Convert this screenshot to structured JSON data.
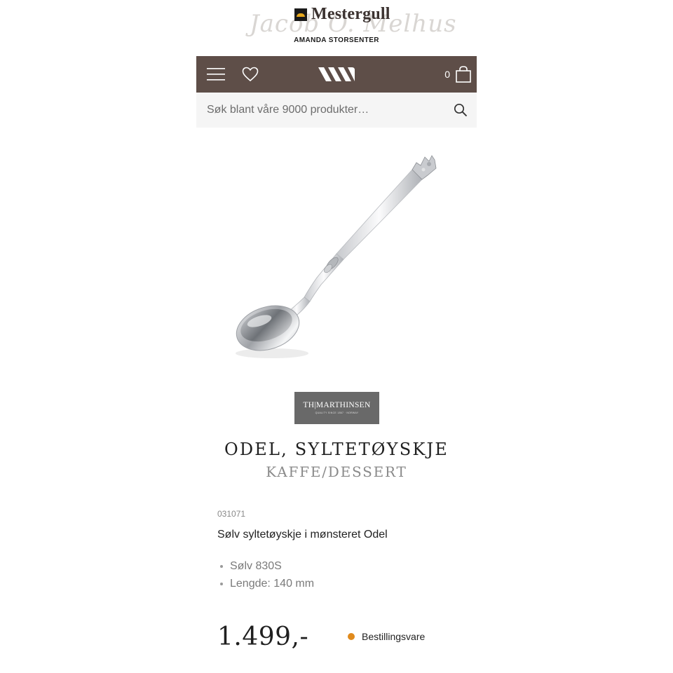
{
  "header": {
    "brand": "Mestergull",
    "script_text": "Jacob O. Melhus",
    "store": "AMANDA STORSENTER"
  },
  "nav": {
    "menu_icon": "hamburger-menu-icon",
    "favorites_icon": "heart-icon",
    "home_icon": "m-logo-icon",
    "cart_count": "0",
    "cart_icon": "shopping-bag-icon",
    "bg_color": "#5e4e48"
  },
  "search": {
    "placeholder": "Søk blant våre 9000 produkter…",
    "icon": "search-icon"
  },
  "product": {
    "brand_badge": {
      "name": "TH|MARTHINSEN",
      "tagline": "QUALITY SINCE 1867 · NORWAY"
    },
    "title": "ODEL, SYLTETØYSKJE",
    "category": "KAFFE/DESSERT",
    "sku": "031071",
    "short_description": "Sølv syltetøyskje i mønsteret Odel",
    "specs": [
      "Sølv 830S",
      "Lengde: 140 mm"
    ],
    "price": "1.499,-",
    "stock_status": "Bestillingsvare",
    "stock_color": "#e08a1c"
  }
}
